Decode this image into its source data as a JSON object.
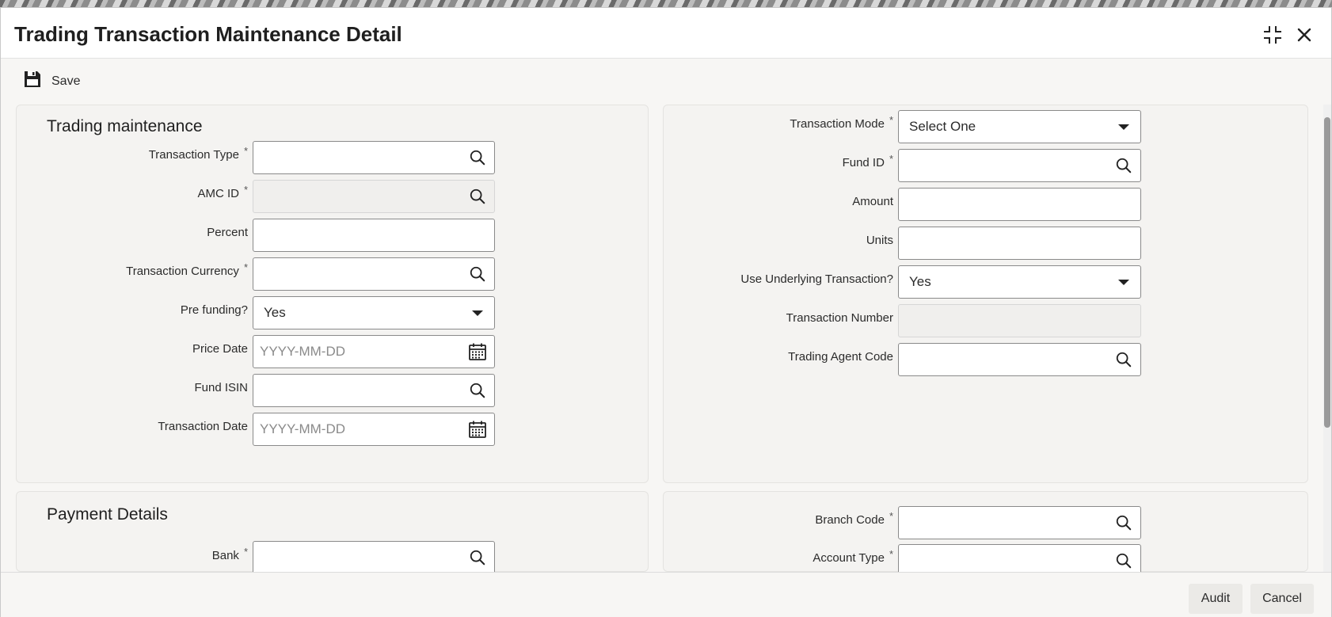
{
  "window": {
    "title": "Trading Transaction Maintenance Detail"
  },
  "toolbar": {
    "save_label": "Save"
  },
  "trading": {
    "section_title": "Trading maintenance",
    "transaction_type": {
      "label": "Transaction Type",
      "required": "*",
      "value": ""
    },
    "amc_id": {
      "label": "AMC ID",
      "required": "*",
      "value": ""
    },
    "percent": {
      "label": "Percent",
      "value": ""
    },
    "transaction_currency": {
      "label": "Transaction Currency",
      "required": "*",
      "value": ""
    },
    "pre_funding": {
      "label": "Pre funding?",
      "value": "Yes"
    },
    "price_date": {
      "label": "Price Date",
      "placeholder": "YYYY-MM-DD"
    },
    "fund_isin": {
      "label": "Fund ISIN",
      "value": ""
    },
    "transaction_date": {
      "label": "Transaction Date",
      "placeholder": "YYYY-MM-DD"
    },
    "transaction_mode": {
      "label": "Transaction Mode",
      "required": "*",
      "value": "Select One"
    },
    "fund_id": {
      "label": "Fund ID",
      "required": "*",
      "value": ""
    },
    "amount": {
      "label": "Amount",
      "value": ""
    },
    "units": {
      "label": "Units",
      "value": ""
    },
    "use_underlying": {
      "label": "Use Underlying Transaction?",
      "value": "Yes"
    },
    "transaction_number": {
      "label": "Transaction Number",
      "value": ""
    },
    "trading_agent_code": {
      "label": "Trading Agent Code",
      "value": ""
    }
  },
  "payment": {
    "section_title": "Payment Details",
    "bank": {
      "label": "Bank",
      "required": "*",
      "value": ""
    },
    "branch_code": {
      "label": "Branch Code",
      "required": "*",
      "value": ""
    },
    "account_type": {
      "label": "Account Type",
      "required": "*",
      "value": ""
    }
  },
  "footer": {
    "audit_label": "Audit",
    "cancel_label": "Cancel"
  },
  "icons": [
    "maximize-icon",
    "close-icon",
    "save-icon",
    "search-icon",
    "calendar-icon",
    "dropdown-caret-icon"
  ]
}
